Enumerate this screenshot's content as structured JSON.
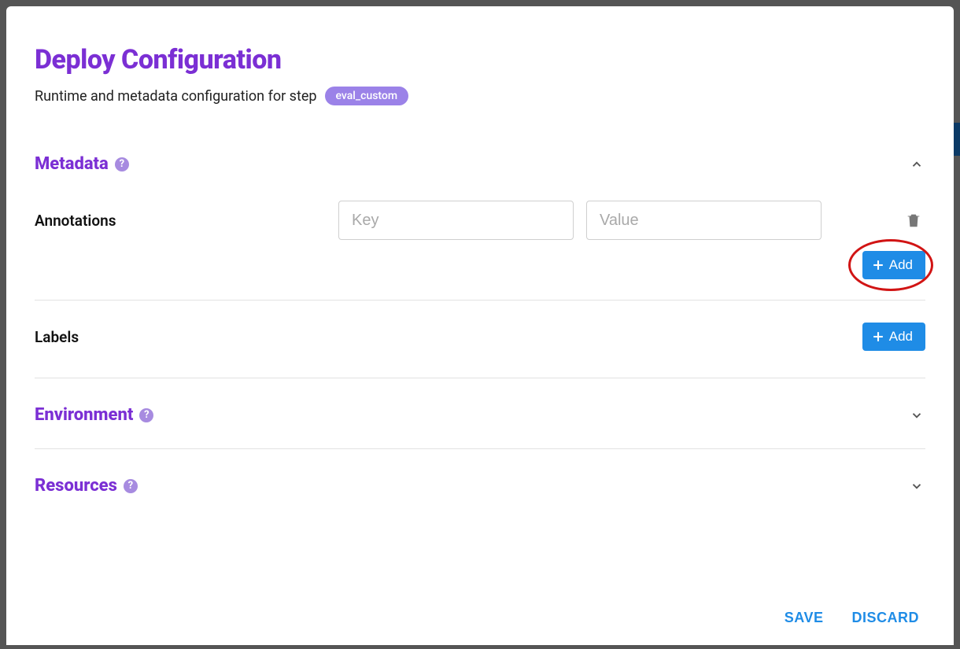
{
  "header": {
    "title": "Deploy Configuration",
    "subtitle_prefix": "Runtime and metadata configuration for step",
    "step_name": "eval_custom"
  },
  "sections": {
    "metadata": {
      "title": "Metadata",
      "expanded": true,
      "fields": {
        "annotations": {
          "label": "Annotations",
          "key_placeholder": "Key",
          "value_placeholder": "Value",
          "key_value": "",
          "value_value": "",
          "add_label": "Add"
        },
        "labels": {
          "label": "Labels",
          "add_label": "Add"
        }
      }
    },
    "environment": {
      "title": "Environment",
      "expanded": false
    },
    "resources": {
      "title": "Resources",
      "expanded": false
    }
  },
  "footer": {
    "save": "SAVE",
    "discard": "DISCARD"
  }
}
